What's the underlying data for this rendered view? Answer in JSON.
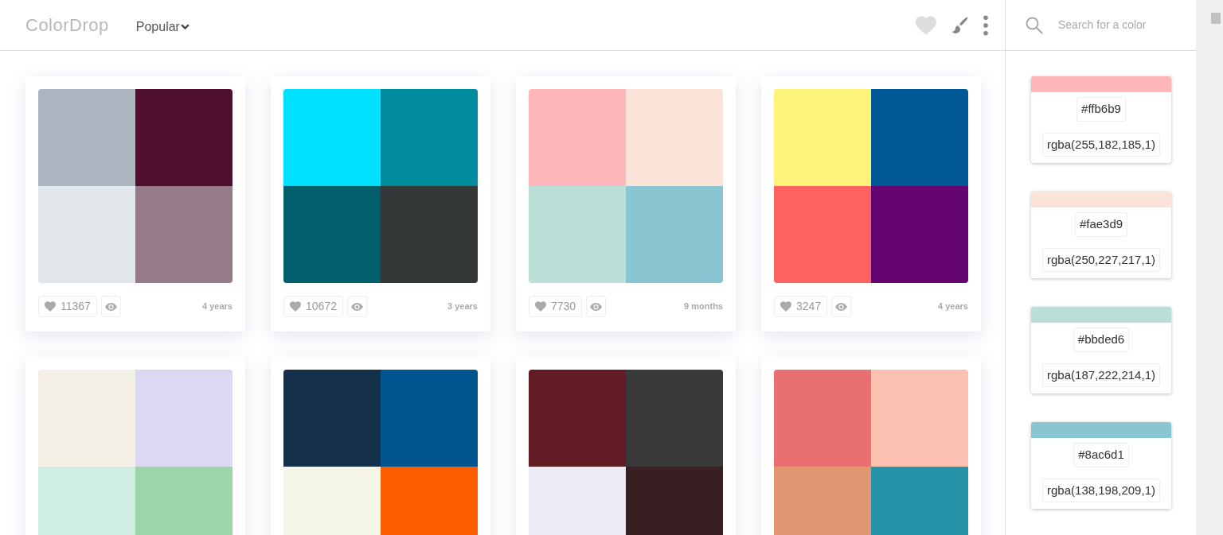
{
  "header": {
    "logo": "ColorDrop",
    "sort_menu": {
      "label": "Popular"
    },
    "search": {
      "placeholder": "Search for a color"
    }
  },
  "palettes": [
    {
      "swatches": [
        {
          "color": "#abb6c1"
        },
        {
          "color": "#4e0f2d"
        },
        {
          "color": "#e1e6ea"
        },
        {
          "color": "#957b87"
        }
      ],
      "likes": "11367",
      "age": "4 years"
    },
    {
      "swatches": [
        {
          "color": "#00e0ff"
        },
        {
          "color": "#008b9e"
        },
        {
          "color": "#005f6b"
        },
        {
          "color": "#343838"
        }
      ],
      "likes": "10672",
      "age": "3 years"
    },
    {
      "swatches": [
        {
          "color": "#ffb6b9"
        },
        {
          "color": "#fae3d9"
        },
        {
          "color": "#bbded6"
        },
        {
          "color": "#8ac6d1"
        }
      ],
      "likes": "7730",
      "age": "9 months"
    },
    {
      "swatches": [
        {
          "color": "#fcf479"
        },
        {
          "color": "#005796"
        },
        {
          "color": "#fc6260"
        },
        {
          "color": "#640470"
        }
      ],
      "likes": "3247",
      "age": "4 years"
    },
    {
      "swatches": [
        {
          "color": "#f3efe5"
        },
        {
          "color": "#dad8f3"
        },
        {
          "color": "#cfede2"
        },
        {
          "color": "#9dd4a8"
        }
      ]
    },
    {
      "swatches": [
        {
          "color": "#14304a"
        },
        {
          "color": "#00558f"
        },
        {
          "color": "#f5f6e8"
        },
        {
          "color": "#ff5e00"
        }
      ]
    },
    {
      "swatches": [
        {
          "color": "#621c24"
        },
        {
          "color": "#393939"
        },
        {
          "color": "#ecebf4"
        },
        {
          "color": "#381f21"
        }
      ]
    },
    {
      "swatches": [
        {
          "color": "#e9706f"
        },
        {
          "color": "#fcc1b1"
        },
        {
          "color": "#e39672"
        },
        {
          "color": "#2593a8"
        }
      ]
    }
  ],
  "selected_colors": [
    {
      "color": "#ffb6b9",
      "hex": "#ffb6b9",
      "rgba": "rgba(255,182,185,1)"
    },
    {
      "color": "#fae3d9",
      "hex": "#fae3d9",
      "rgba": "rgba(250,227,217,1)"
    },
    {
      "color": "#bbded6",
      "hex": "#bbded6",
      "rgba": "rgba(187,222,214,1)"
    },
    {
      "color": "#8ac6d1",
      "hex": "#8ac6d1",
      "rgba": "rgba(138,198,209,1)"
    }
  ]
}
